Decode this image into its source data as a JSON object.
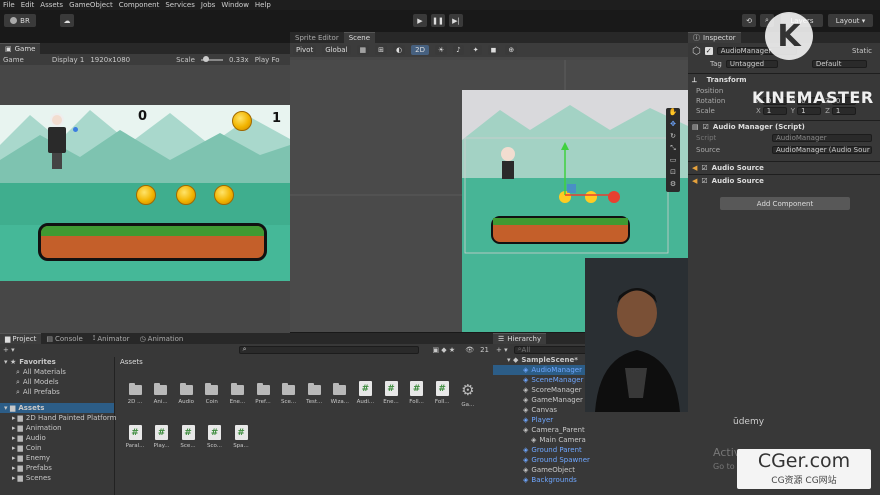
{
  "menu": [
    "File",
    "Edit",
    "Assets",
    "GameObject",
    "Component",
    "Services",
    "Jobs",
    "Window",
    "Help"
  ],
  "toolbar": {
    "account": "BR",
    "layout": "Layout",
    "layers": "Layers"
  },
  "game_panel": {
    "tab": "Game",
    "display_mode": "Game",
    "display": "Display 1",
    "resolution": "1920x1080",
    "scale_label": "Scale",
    "scale_value": "0.33x",
    "play_focused": "Play Fo",
    "score_left": "0",
    "score_right": "1"
  },
  "scene_panel": {
    "tabs": [
      "Sprite Editor",
      "Scene"
    ],
    "pivot": "Pivot",
    "global": "Global",
    "mode_2d": "2D"
  },
  "inspector": {
    "tab": "Inspector",
    "object_name": "AudioManager",
    "static_label": "Static",
    "tag_label": "Tag",
    "tag_value": "Untagged",
    "layer_value": "Default",
    "transform": {
      "title": "Transform",
      "position_label": "Position",
      "rotation_label": "Rotation",
      "scale_label": "Scale",
      "position": {
        "x": "",
        "y": "",
        "z": ""
      },
      "rotation": {
        "x": "0",
        "y": "0",
        "z": "0"
      },
      "scale": {
        "x": "1",
        "y": "1",
        "z": "1"
      }
    },
    "audio_manager": {
      "title": "Audio Manager (Script)",
      "script_label": "Script",
      "script_value": "AudioManager",
      "source_label": "Source",
      "source_value": "AudioManager (Audio Sour"
    },
    "audio_sources": [
      "Audio Source",
      "Audio Source"
    ],
    "add_component": "Add Component"
  },
  "project": {
    "tabs": [
      "Project",
      "Console",
      "Animator",
      "Animation"
    ],
    "favorites_title": "Favorites",
    "favorites": [
      "All Materials",
      "All Models",
      "All Prefabs"
    ],
    "assets_title": "Assets",
    "folders": [
      "2D Hand Painted Platform",
      "Animation",
      "Audio",
      "Coin",
      "Enemy",
      "Prefabs",
      "Scenes"
    ],
    "breadcrumb": "Assets",
    "asset_count": "21",
    "grid_row1": [
      "2D ...",
      "Ani...",
      "Audio",
      "Coin",
      "Ene...",
      "Pref...",
      "Sce...",
      "Test...",
      "Wiza...",
      "Audi...",
      "Ene...",
      "Foll...",
      "Foll...",
      "Ga..."
    ],
    "grid_row2": [
      "Paral...",
      "Play...",
      "Sce...",
      "Sco...",
      "Spa..."
    ]
  },
  "hierarchy": {
    "tab": "Hierarchy",
    "search_placeholder": "All",
    "scene": "SampleScene*",
    "items": [
      {
        "label": "AudioManager",
        "depth": 1,
        "prefab": true,
        "selected": true
      },
      {
        "label": "SceneManager",
        "depth": 1,
        "prefab": true
      },
      {
        "label": "ScoreManager",
        "depth": 1,
        "prefab": false
      },
      {
        "label": "GameManager",
        "depth": 1,
        "prefab": false
      },
      {
        "label": "Canvas",
        "depth": 1,
        "prefab": false
      },
      {
        "label": "Player",
        "depth": 1,
        "prefab": true
      },
      {
        "label": "Camera_Parent",
        "depth": 1,
        "prefab": false
      },
      {
        "label": "Main Camera",
        "depth": 2,
        "prefab": false
      },
      {
        "label": "Ground Parent",
        "depth": 1,
        "prefab": true
      },
      {
        "label": "Ground Spawner",
        "depth": 1,
        "prefab": true
      },
      {
        "label": "GameObject",
        "depth": 1,
        "prefab": false
      },
      {
        "label": "Backgrounds",
        "depth": 1,
        "prefab": true
      }
    ]
  },
  "watermarks": {
    "kinemaster": "KINEMASTER",
    "k_logo": "K",
    "udemy": "ūdemy",
    "activate": "Activ",
    "goto": "Go to",
    "cger": "CGer.com",
    "cger_sub": "CG资源  CG网站"
  },
  "colors": {
    "accent_blue": "#6fa7ff",
    "selection": "#2c5d87",
    "panel": "#383838"
  }
}
